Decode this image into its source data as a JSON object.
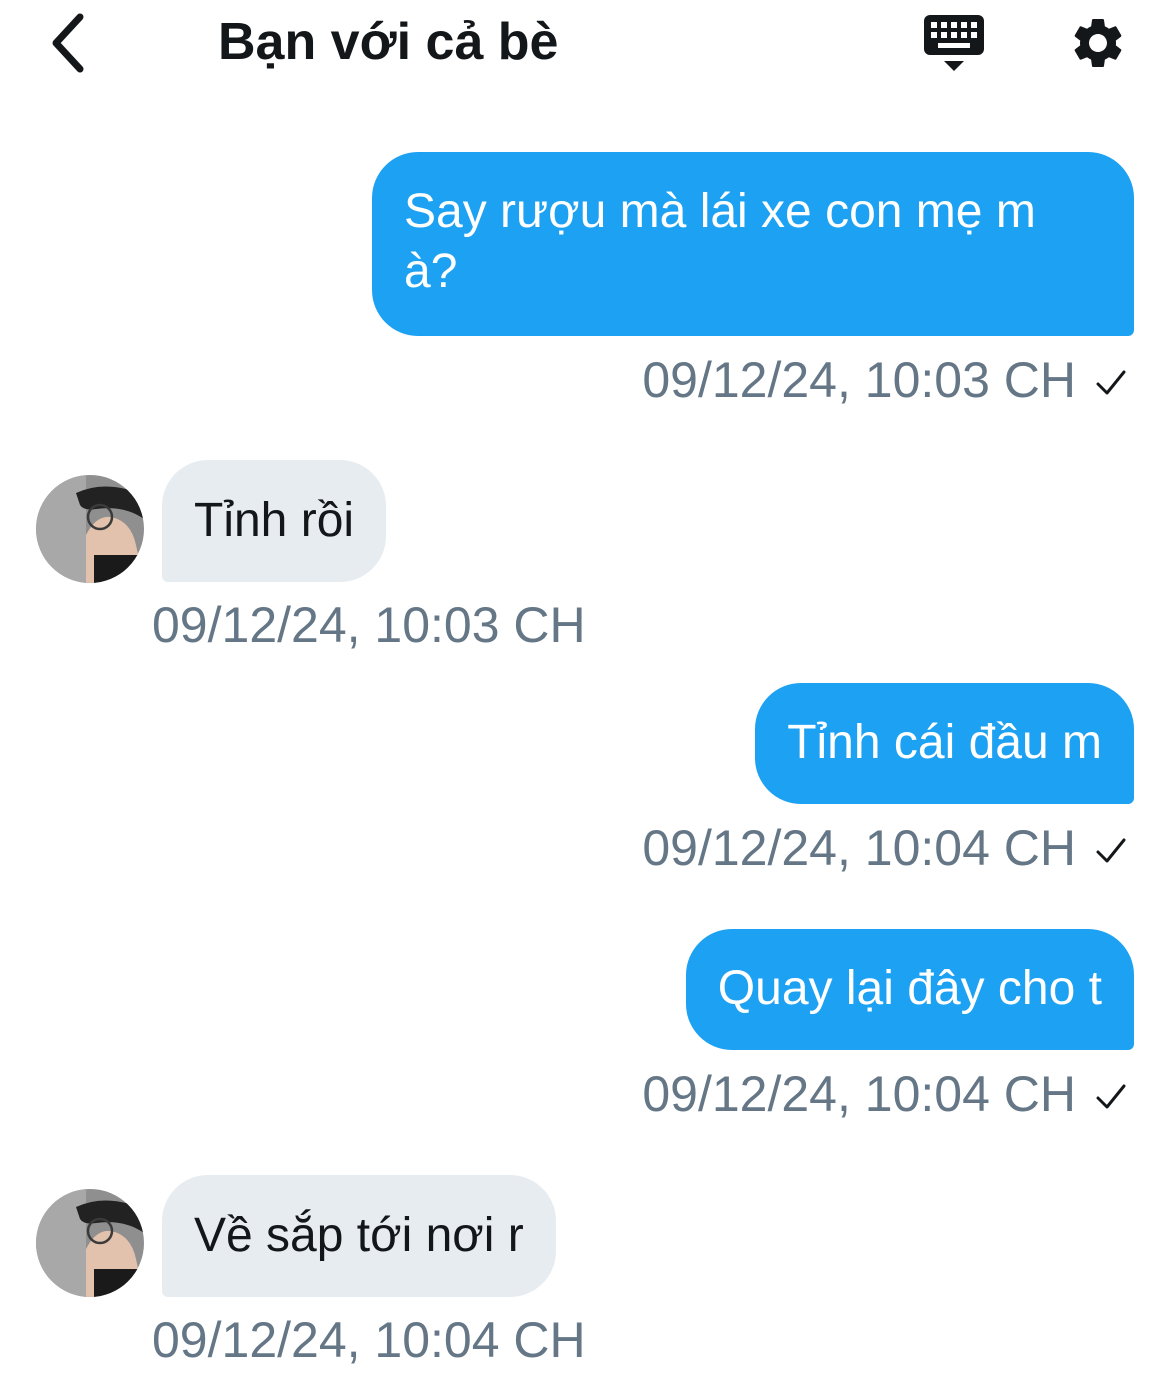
{
  "header": {
    "title": "Bạn với cả bè"
  },
  "messages": [
    {
      "direction": "out",
      "text_line1": "Say rượu mà lái xe con mẹ m",
      "text_line2": "à?",
      "timestamp": "09/12/24, 10:03 CH",
      "read": true
    },
    {
      "direction": "in",
      "text": "Tỉnh rồi",
      "timestamp": "09/12/24, 10:03 CH"
    },
    {
      "direction": "out",
      "text": "Tỉnh cái đầu m",
      "timestamp": "09/12/24, 10:04 CH",
      "read": true
    },
    {
      "direction": "out",
      "text": "Quay lại đây cho t",
      "timestamp": "09/12/24, 10:04 CH",
      "read": true
    },
    {
      "direction": "in",
      "text": "Về sắp tới nơi r",
      "timestamp": "09/12/24, 10:04 CH"
    }
  ],
  "icons": {
    "back": "chevron-left-icon",
    "keyboard": "keyboard-icon",
    "settings": "gear-icon",
    "read_receipt": "checkmark-icon"
  },
  "colors": {
    "outgoing_bubble": "#1da1f2",
    "incoming_bubble": "#e6ecf0",
    "timestamp": "#657786",
    "text": "#14171a"
  }
}
